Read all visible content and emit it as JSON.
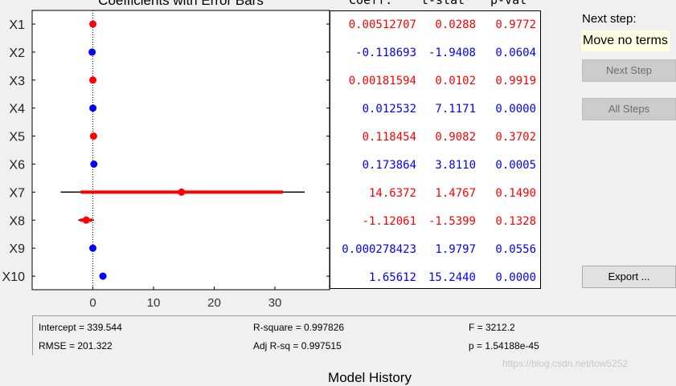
{
  "plot": {
    "title": "Coefficients with Error Bars",
    "xlim": [
      -10,
      39
    ],
    "xticks": [
      "0",
      "10",
      "20",
      "30"
    ],
    "colors": {
      "in_model": "#0000ff",
      "out_of_model": "#ff0000",
      "outer_bar": "#000000"
    },
    "terms": [
      {
        "name": "X1",
        "value": 0.005,
        "status": "out"
      },
      {
        "name": "X2",
        "value": -0.119,
        "status": "in"
      },
      {
        "name": "X3",
        "value": 0.002,
        "status": "out"
      },
      {
        "name": "X4",
        "value": 0.013,
        "status": "in"
      },
      {
        "name": "X5",
        "value": 0.118,
        "status": "out"
      },
      {
        "name": "X6",
        "value": 0.174,
        "status": "in"
      },
      {
        "name": "X7",
        "value": 14.6,
        "status": "out",
        "inner": [
          -2.0,
          31.3
        ],
        "outer": [
          -5.3,
          34.9
        ]
      },
      {
        "name": "X8",
        "value": -1.1,
        "status": "out",
        "inner": [
          -2.1,
          -0.1
        ],
        "outer": [
          -2.4,
          0.2
        ]
      },
      {
        "name": "X9",
        "value": 0.0003,
        "status": "in"
      },
      {
        "name": "X10",
        "value": 1.66,
        "status": "in"
      }
    ]
  },
  "table": {
    "headers": {
      "coef": "Coeff.",
      "t": "t-stat",
      "p": "p-val"
    },
    "rows": [
      {
        "coef": "0.00512707",
        "t": "0.0288",
        "p": "0.9772",
        "color": "red"
      },
      {
        "coef": "-0.118693",
        "t": "-1.9408",
        "p": "0.0604",
        "color": "blue"
      },
      {
        "coef": "0.00181594",
        "t": "0.0102",
        "p": "0.9919",
        "color": "red"
      },
      {
        "coef": "0.012532",
        "t": "7.1171",
        "p": "0.0000",
        "color": "blue"
      },
      {
        "coef": "0.118454",
        "t": "0.9082",
        "p": "0.3702",
        "color": "red"
      },
      {
        "coef": "0.173864",
        "t": "3.8110",
        "p": "0.0005",
        "color": "blue"
      },
      {
        "coef": "14.6372",
        "t": "1.4767",
        "p": "0.1490",
        "color": "red"
      },
      {
        "coef": "-1.12061",
        "t": "-1.5399",
        "p": "0.1328",
        "color": "red"
      },
      {
        "coef": "0.000278423",
        "t": "1.9797",
        "p": "0.0556",
        "color": "blue"
      },
      {
        "coef": "1.65612",
        "t": "15.2440",
        "p": "0.0000",
        "color": "blue"
      }
    ]
  },
  "side": {
    "next_step_label": "Next step:",
    "move_text": "Move no terms",
    "next_step_button": "Next Step",
    "all_steps_button": "All Steps",
    "export_button": "Export ..."
  },
  "stats": {
    "intercept": "Intercept = 339.544",
    "rmse": "RMSE = 201.322",
    "rsquare": "R-square = 0.997826",
    "adj_rsq": "Adj R-sq = 0.997515",
    "f": "F = 3212.2",
    "p": "p = 1.54188e-45"
  },
  "history": {
    "title": "Model History"
  },
  "watermark": "https://blog.csdn.net/tow5252"
}
